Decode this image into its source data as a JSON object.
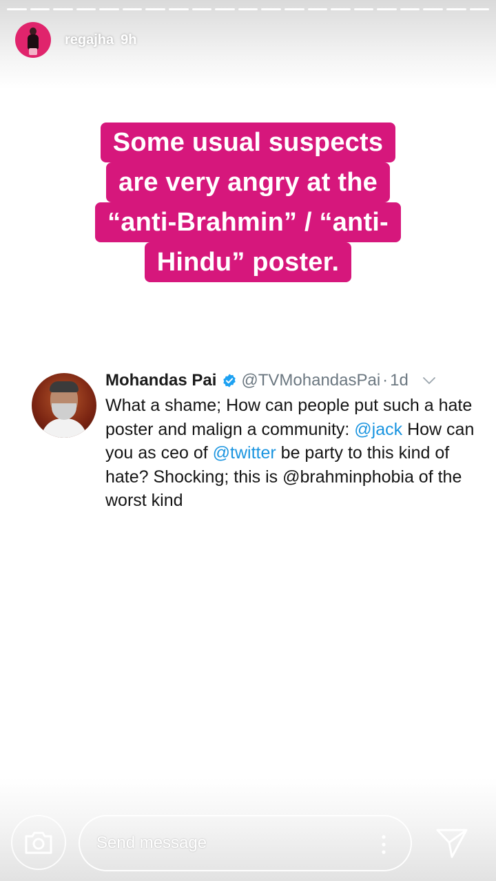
{
  "story": {
    "username": "regajha",
    "time_ago": "9h",
    "progress_segments": 21
  },
  "caption": {
    "lines": [
      "Some usual suspects",
      "are very angry at the",
      "“anti-Brahmin” / “anti-",
      "Hindu” poster."
    ],
    "background_color": "#d6177c"
  },
  "tweet": {
    "author_name": "Mohandas Pai",
    "verified": true,
    "handle": "@TVMohandasPai",
    "separator": "·",
    "time": "1d",
    "text_part1": "What a shame; How can people  put such a hate poster and malign  a community:",
    "mention_1": "@jack",
    "text_part2": " How can you as ceo of ",
    "mention_2": "@twitter",
    "text_part3": " be party to this kind of hate? Shocking; this is @brahminphobia of the worst kind",
    "mention_color": "#1b95e0"
  },
  "reply_bar": {
    "placeholder": "Send message",
    "icons": [
      "camera-icon",
      "more-icon",
      "direct-icon"
    ]
  }
}
